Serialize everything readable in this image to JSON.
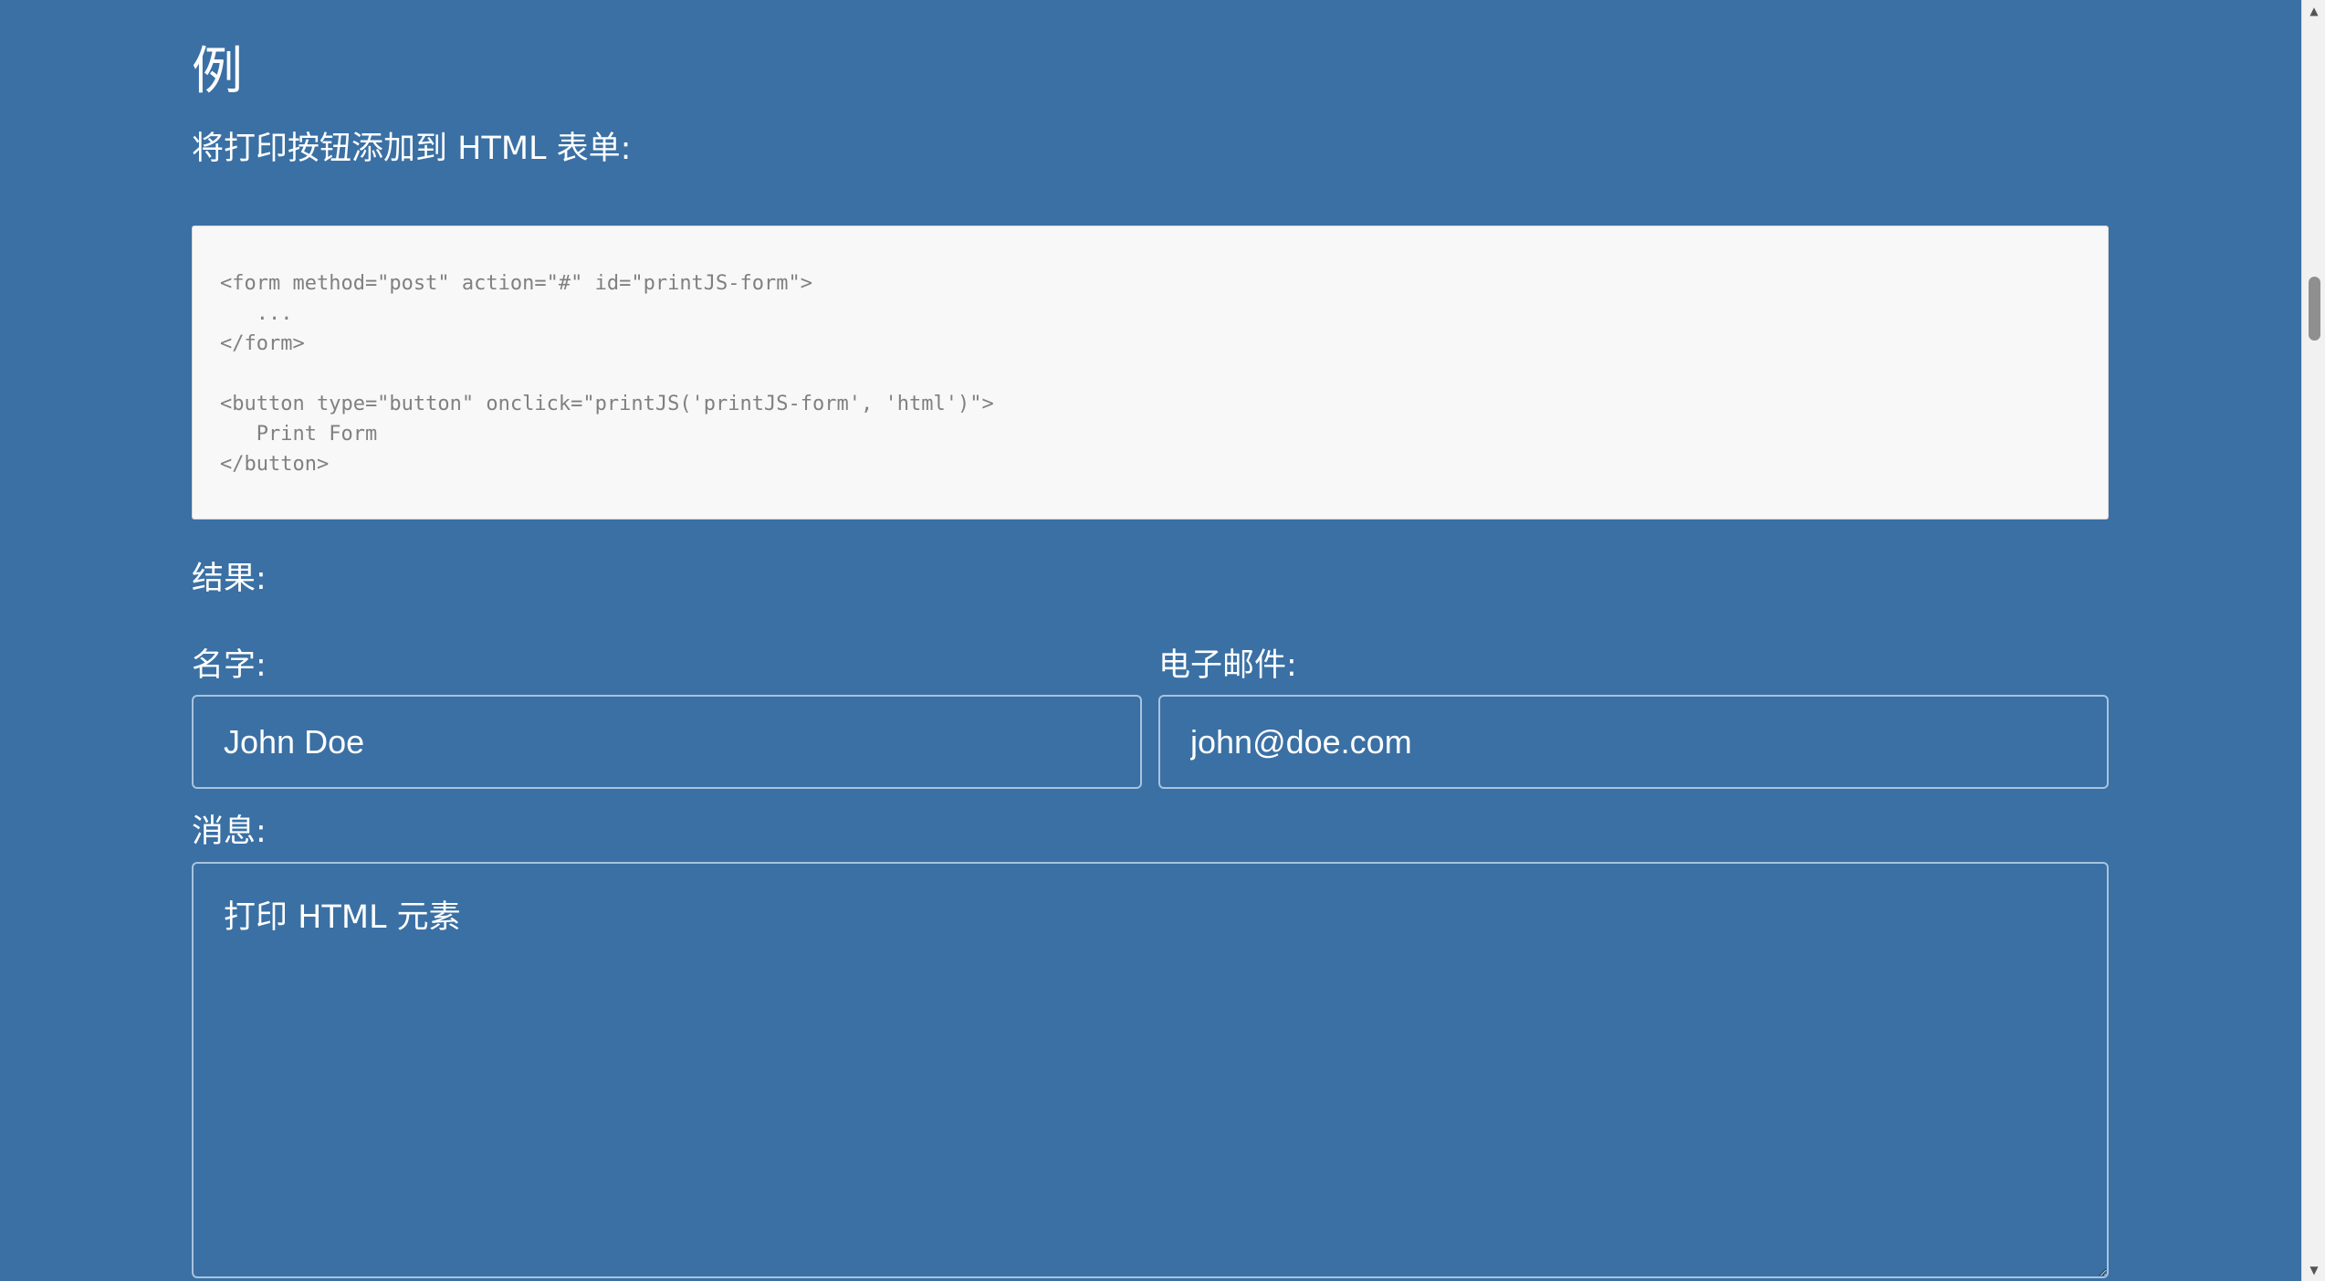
{
  "example": {
    "heading": "例",
    "intro": "将打印按钮添加到 HTML 表单:"
  },
  "code": {
    "lines": "<form method=\"post\" action=\"#\" id=\"printJS-form\">\n   ...\n</form>\n\n<button type=\"button\" onclick=\"printJS('printJS-form', 'html')\">\n   Print Form\n</button>"
  },
  "result": {
    "label": "结果:"
  },
  "form": {
    "name_label": "名字:",
    "name_value": "John Doe",
    "email_label": "电子邮件:",
    "email_value": "john@doe.com",
    "message_label": "消息:",
    "message_value": "打印 HTML 元素"
  },
  "scrollbar": {
    "up_icon": "triangle-up",
    "down_icon": "triangle-down"
  },
  "colors": {
    "page_background": "#3a70a4",
    "code_background": "#f8f8f8",
    "code_text": "#808080",
    "input_border": "#a9c3dd"
  }
}
